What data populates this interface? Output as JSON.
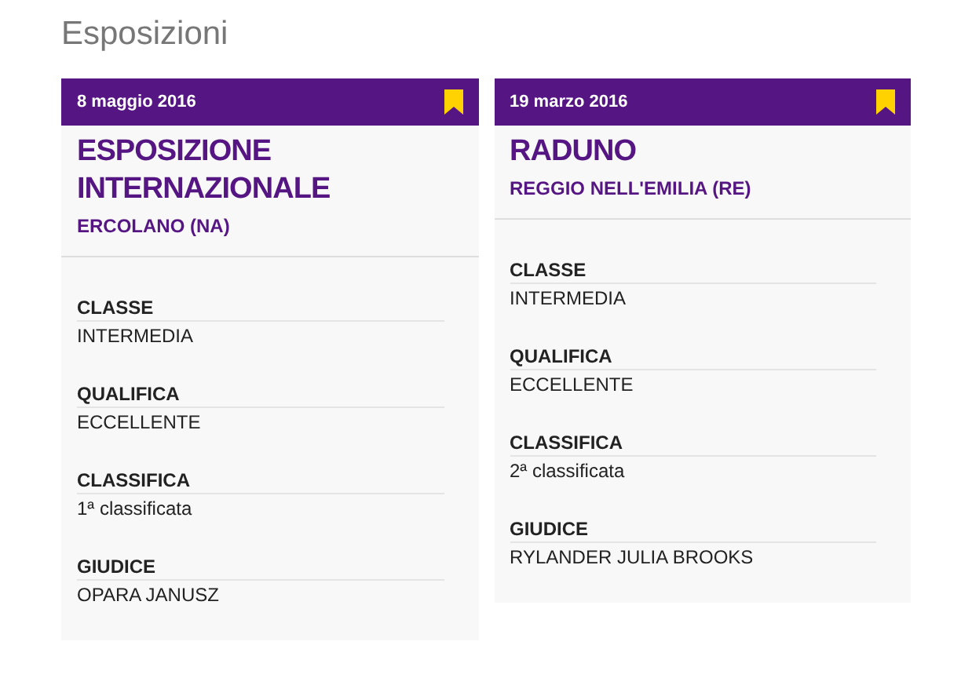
{
  "heading": "Esposizioni",
  "cards": [
    {
      "date": "8 maggio 2016",
      "bookmarked": true,
      "title": "ESPOSIZIONE INTERNAZIONALE",
      "location": "ERCOLANO (NA)",
      "fields": [
        {
          "label": "CLASSE",
          "value": "INTERMEDIA"
        },
        {
          "label": "QUALIFICA",
          "value": "ECCELLENTE"
        },
        {
          "label": "CLASSIFICA",
          "value": "1ª classificata"
        },
        {
          "label": "GIUDICE",
          "value": "OPARA JANUSZ"
        }
      ]
    },
    {
      "date": "19 marzo 2016",
      "bookmarked": true,
      "title": "RADUNO",
      "location": "REGGIO NELL'EMILIA (RE)",
      "fields": [
        {
          "label": "CLASSE",
          "value": "INTERMEDIA"
        },
        {
          "label": "QUALIFICA",
          "value": "ECCELLENTE"
        },
        {
          "label": "CLASSIFICA",
          "value": "2ª classificata"
        },
        {
          "label": "GIUDICE",
          "value": "RYLANDER JULIA BROOKS"
        }
      ]
    }
  ]
}
